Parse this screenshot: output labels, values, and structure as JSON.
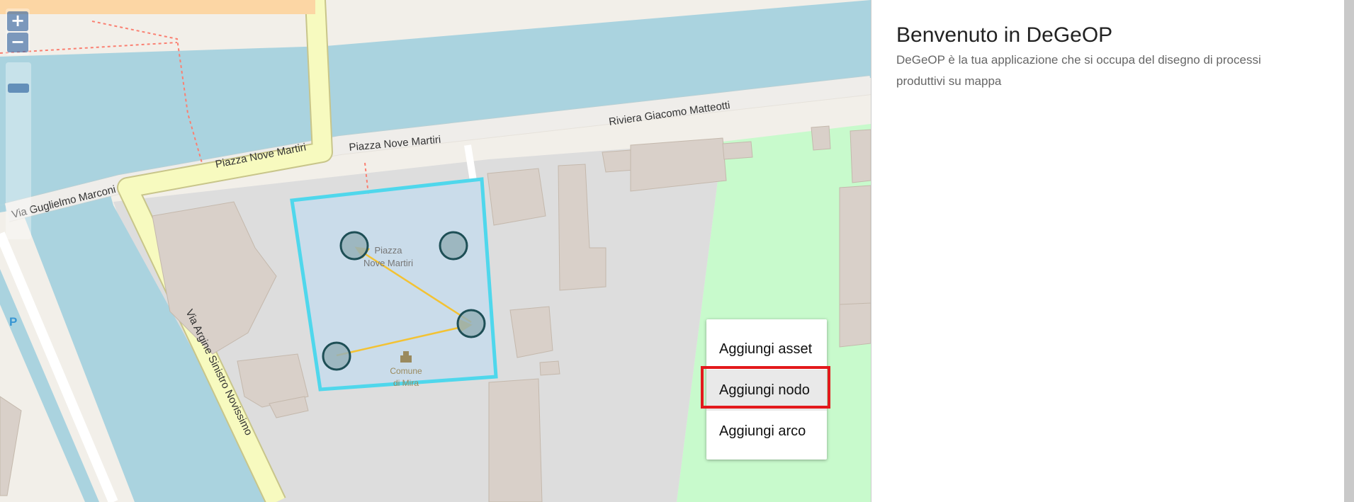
{
  "map": {
    "zoom_in_label": "+",
    "zoom_out_label": "−",
    "streets": [
      "Piazza Nove Martiri",
      "Piazza Nove Martiri",
      "Riviera Giacomo Matteotti",
      "Via Guglielmo Marconi",
      "Via Argine Sinistro Novissimo"
    ],
    "poi": {
      "piazza_line1": "Piazza",
      "piazza_line2": "Nove Martiri",
      "comune_line1": "Comune",
      "comune_line2": "di Mira",
      "parking": "P"
    },
    "colors": {
      "selection": "#4fd7ec",
      "node_fill": "#95b0b8",
      "node_stroke": "#1e4f56",
      "edge": "#f3c233",
      "water": "#aad3df",
      "grass": "#c8facc",
      "building": "#d9d0c9"
    }
  },
  "context_menu": {
    "items": [
      {
        "label": "Aggiungi asset"
      },
      {
        "label": "Aggiungi nodo"
      },
      {
        "label": "Aggiungi arco"
      }
    ],
    "highlighted_item": "Aggiungi nodo"
  },
  "panel": {
    "title": "Benvenuto in DeGeOP",
    "description": "DeGeOP è la tua applicazione che si occupa del disegno di processi produttivi su mappa"
  }
}
